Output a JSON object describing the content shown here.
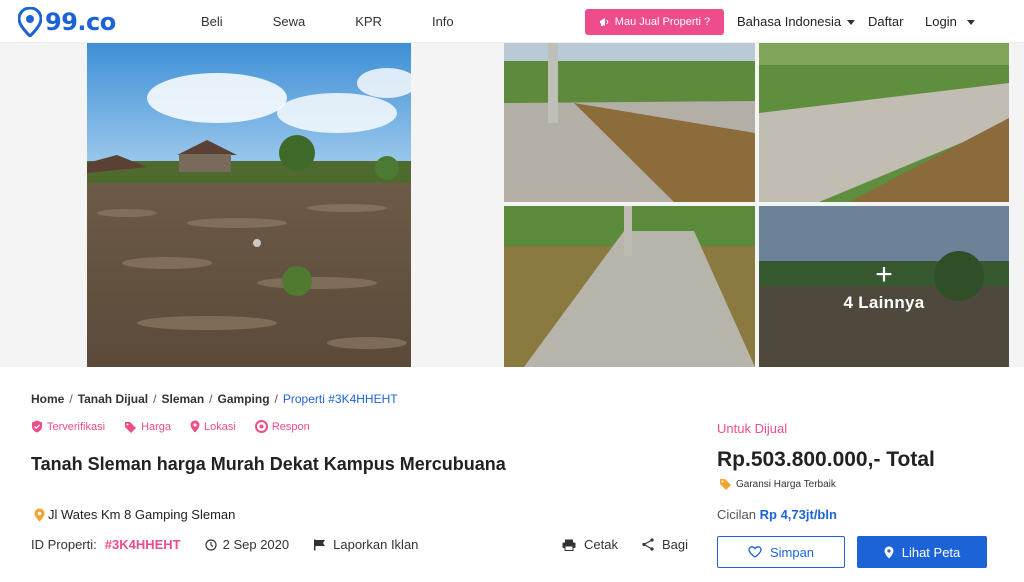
{
  "header": {
    "logo_text": "99.co",
    "nav": [
      "Beli",
      "Sewa",
      "KPR",
      "Info"
    ],
    "sell_button": "Mau Jual Properti ?",
    "language": "Bahasa Indonesia",
    "register": "Daftar",
    "login": "Login"
  },
  "gallery": {
    "more_label": "4 Lainnya",
    "more_plus": "+"
  },
  "breadcrumb": {
    "home": "Home",
    "category": "Tanah Dijual",
    "region": "Sleman",
    "district": "Gamping",
    "current": "Properti #3K4HHEHT",
    "separator": "/"
  },
  "badges": {
    "verified": "Terverifikasi",
    "price": "Harga",
    "location": "Lokasi",
    "response": "Respon"
  },
  "listing": {
    "title": "Tanah Sleman harga Murah Dekat Kampus Mercubuana",
    "address": "Jl Wates Km 8 Gamping Sleman",
    "id_label": "ID Properti:",
    "id_value": "#3K4HHEHT",
    "date": "2 Sep 2020",
    "report": "Laporkan Iklan",
    "print": "Cetak",
    "share": "Bagi"
  },
  "pricing": {
    "status": "Untuk Dijual",
    "price": "Rp.503.800.000,- Total",
    "guarantee": "Garansi Harga Terbaik",
    "installment_label": "Cicilan",
    "installment_value": "Rp 4,73jt/bln",
    "save_button": "Simpan",
    "map_button": "Lihat Peta"
  },
  "colors": {
    "brand_blue": "#1d63d8",
    "accent_pink": "#ee4d8b"
  }
}
